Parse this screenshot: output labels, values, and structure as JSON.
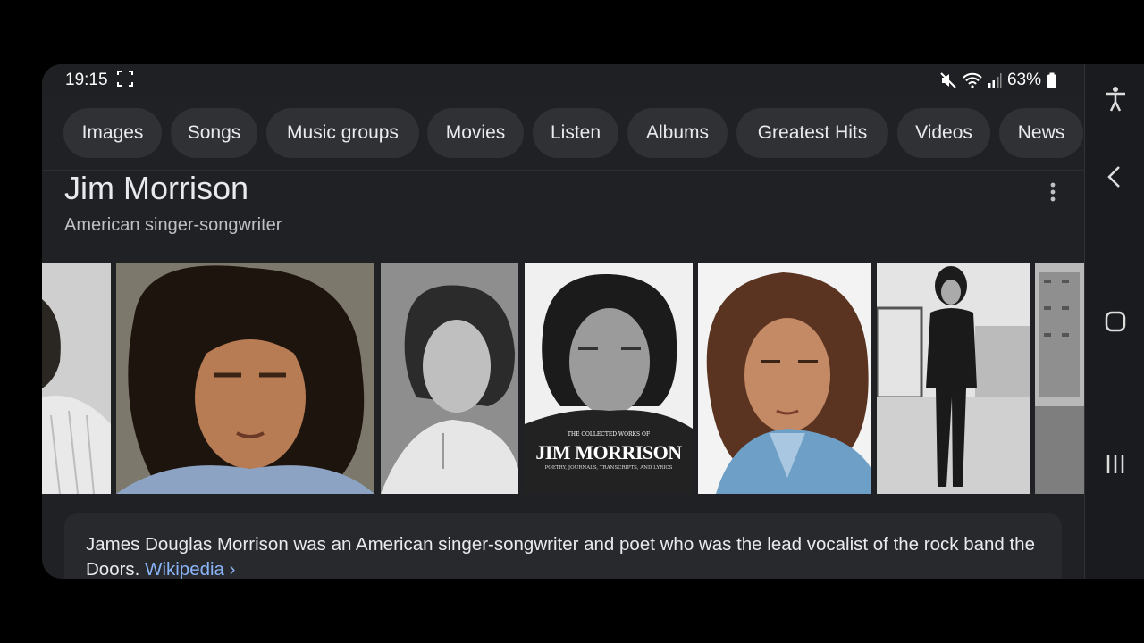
{
  "status": {
    "time": "19:15",
    "battery": "63%"
  },
  "chips": [
    "Images",
    "Songs",
    "Music groups",
    "Movies",
    "Listen",
    "Albums",
    "Greatest Hits",
    "Videos",
    "News"
  ],
  "entity": {
    "title": "Jim Morrison",
    "subtitle": "American singer-songwriter"
  },
  "gallery": {
    "cover_title_small": "THE COLLECTED WORKS OF",
    "cover_title": "JIM MORRISON",
    "cover_subtitle": "POETRY, JOURNALS, TRANSCRIPTS, AND LYRICS"
  },
  "description": {
    "text": "James Douglas Morrison was an American singer-songwriter and poet who was the lead vocalist of the rock band the Doors.",
    "source_link": "Wikipedia",
    "chevron": "›"
  },
  "icons": {
    "screenshot": "screenshot-corners-icon",
    "mute": "mute-icon",
    "wifi": "wifi-icon",
    "signal": "signal-icon",
    "battery": "battery-icon",
    "more": "more-vert-icon",
    "accessibility": "accessibility-icon",
    "back": "back-icon",
    "home": "home-icon",
    "recents": "recents-icon"
  }
}
